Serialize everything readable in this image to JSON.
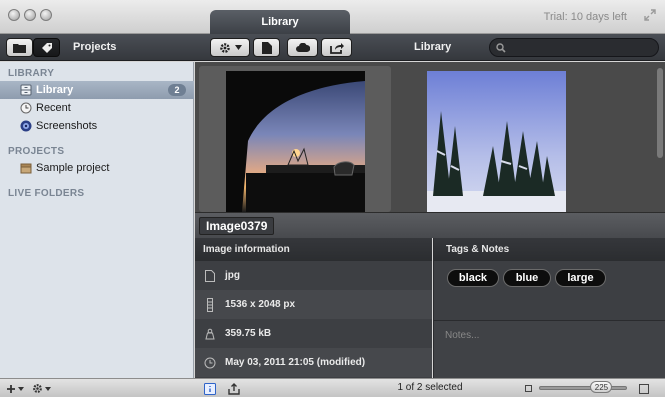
{
  "window": {
    "active_tab": "Library",
    "trial_text": "Trial: 10 days left"
  },
  "toolbar": {
    "projects_label": "Projects",
    "center_title": "Library",
    "search_placeholder": ""
  },
  "sidebar": {
    "library_heading": "LIBRARY",
    "library_items": [
      {
        "label": "Library",
        "badge": "2",
        "icon": "library-drawer-icon",
        "selected": true
      },
      {
        "label": "Recent",
        "icon": "clock-icon"
      },
      {
        "label": "Screenshots",
        "icon": "screenshots-icon"
      }
    ],
    "projects_heading": "PROJECTS",
    "project_items": [
      {
        "label": "Sample project",
        "icon": "project-box-icon"
      }
    ],
    "live_folders_heading": "LIVE FOLDERS"
  },
  "browser": {
    "images": [
      "sunset-car-photo",
      "snowy-trees-photo"
    ]
  },
  "image": {
    "title": "Image0379"
  },
  "info": {
    "heading": "Image information",
    "rows": [
      {
        "icon": "file-icon",
        "value": "jpg"
      },
      {
        "icon": "dimensions-icon",
        "value": "1536 x 2048 px"
      },
      {
        "icon": "weight-icon",
        "value": "359.75 kB"
      },
      {
        "icon": "clock-icon",
        "value": "May 03, 2011 21:05 (modified)"
      }
    ]
  },
  "tags": {
    "heading": "Tags & Notes",
    "items": [
      "black",
      "blue",
      "large"
    ],
    "notes_placeholder": "Notes..."
  },
  "bottombar": {
    "status": "1 of 2 selected",
    "zoom_value": "225",
    "zoom_fraction": 0.78
  }
}
